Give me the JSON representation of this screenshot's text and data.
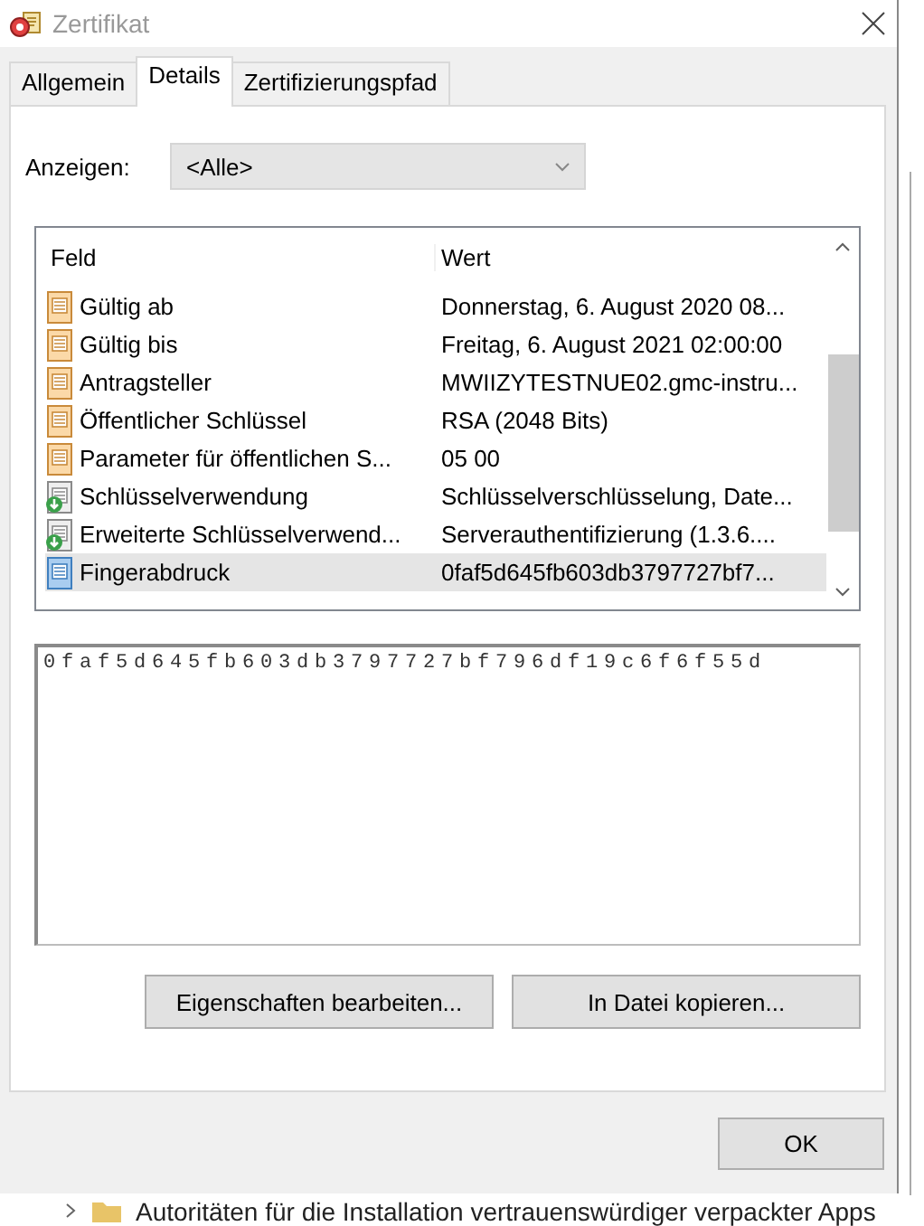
{
  "window": {
    "title": "Zertifikat"
  },
  "tabs": [
    {
      "label": "Allgemein",
      "selected": false
    },
    {
      "label": "Details",
      "selected": true
    },
    {
      "label": "Zertifizierungspfad",
      "selected": false
    }
  ],
  "show_filter": {
    "label": "Anzeigen:",
    "value": "<Alle>"
  },
  "field_list": {
    "columns": [
      "Feld",
      "Wert"
    ],
    "rows": [
      {
        "kind": "property",
        "field": "Gültig ab",
        "value": "Donnerstag, 6. August 2020 08...",
        "selected": false
      },
      {
        "kind": "property",
        "field": "Gültig bis",
        "value": "Freitag, 6. August 2021 02:00:00",
        "selected": false
      },
      {
        "kind": "property",
        "field": "Antragsteller",
        "value": "MWIIZYTESTNUE02.gmc-instru...",
        "selected": false
      },
      {
        "kind": "property",
        "field": "Öffentlicher Schlüssel",
        "value": "RSA (2048 Bits)",
        "selected": false
      },
      {
        "kind": "property",
        "field": "Parameter für öffentlichen S...",
        "value": "05 00",
        "selected": false
      },
      {
        "kind": "extension",
        "field": "Schlüsselverwendung",
        "value": "Schlüsselverschlüsselung, Date...",
        "selected": false
      },
      {
        "kind": "extension",
        "field": "Erweiterte Schlüsselverwend...",
        "value": "Serverauthentifizierung (1.3.6....",
        "selected": false
      },
      {
        "kind": "property",
        "field": "Fingerabdruck",
        "value": "0faf5d645fb603db3797727bf7...",
        "selected": true
      }
    ]
  },
  "detail_text": "0faf5d645fb603db3797727bf796df19c6f6f55d",
  "buttons": [
    "Eigenschaften bearbeiten...",
    "In Datei kopieren..."
  ],
  "footer_button": "OK",
  "background_item": {
    "label": "Autoritäten für die Installation vertrauenswürdiger verpackter Apps"
  }
}
